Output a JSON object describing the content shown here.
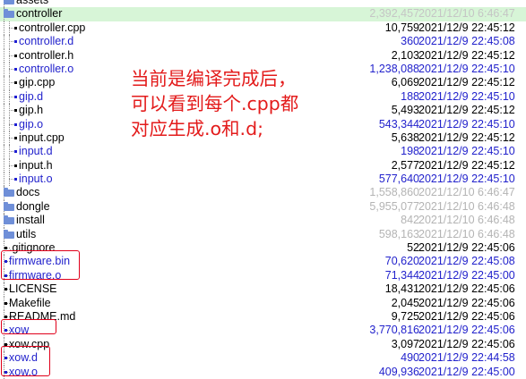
{
  "rows": [
    {
      "kind": "folder",
      "depth": 0,
      "name": "assets",
      "size": "",
      "date": "",
      "style": "",
      "partial": true
    },
    {
      "kind": "folder",
      "depth": 0,
      "name": "controller",
      "size": "2,392,457",
      "date": "2021/12/10 6:46:47",
      "style": "selected"
    },
    {
      "kind": "file",
      "depth": 1,
      "name": "controller.cpp",
      "size": "10,759",
      "date": "2021/12/9 22:45:12",
      "style": ""
    },
    {
      "kind": "file",
      "depth": 1,
      "name": "controller.d",
      "size": "360",
      "date": "2021/12/9 22:45:08",
      "style": "blue"
    },
    {
      "kind": "file",
      "depth": 1,
      "name": "controller.h",
      "size": "2,103",
      "date": "2021/12/9 22:45:12",
      "style": ""
    },
    {
      "kind": "file",
      "depth": 1,
      "name": "controller.o",
      "size": "1,238,088",
      "date": "2021/12/9 22:45:10",
      "style": "blue"
    },
    {
      "kind": "file",
      "depth": 1,
      "name": "gip.cpp",
      "size": "6,069",
      "date": "2021/12/9 22:45:12",
      "style": ""
    },
    {
      "kind": "file",
      "depth": 1,
      "name": "gip.d",
      "size": "188",
      "date": "2021/12/9 22:45:10",
      "style": "blue"
    },
    {
      "kind": "file",
      "depth": 1,
      "name": "gip.h",
      "size": "5,493",
      "date": "2021/12/9 22:45:12",
      "style": ""
    },
    {
      "kind": "file",
      "depth": 1,
      "name": "gip.o",
      "size": "543,344",
      "date": "2021/12/9 22:45:10",
      "style": "blue"
    },
    {
      "kind": "file",
      "depth": 1,
      "name": "input.cpp",
      "size": "5,638",
      "date": "2021/12/9 22:45:12",
      "style": ""
    },
    {
      "kind": "file",
      "depth": 1,
      "name": "input.d",
      "size": "198",
      "date": "2021/12/9 22:45:10",
      "style": "blue"
    },
    {
      "kind": "file",
      "depth": 1,
      "name": "input.h",
      "size": "2,577",
      "date": "2021/12/9 22:45:12",
      "style": ""
    },
    {
      "kind": "file",
      "depth": 1,
      "name": "input.o",
      "size": "577,640",
      "date": "2021/12/9 22:45:10",
      "style": "blue"
    },
    {
      "kind": "folder",
      "depth": 0,
      "name": "docs",
      "size": "1,558,860",
      "date": "2021/12/10 6:46:47",
      "style": "grey"
    },
    {
      "kind": "folder",
      "depth": 0,
      "name": "dongle",
      "size": "5,955,077",
      "date": "2021/12/10 6:46:48",
      "style": "grey"
    },
    {
      "kind": "folder",
      "depth": 0,
      "name": "install",
      "size": "842",
      "date": "2021/12/10 6:46:48",
      "style": "grey"
    },
    {
      "kind": "folder",
      "depth": 0,
      "name": "utils",
      "size": "598,163",
      "date": "2021/12/10 6:46:48",
      "style": "grey"
    },
    {
      "kind": "file",
      "depth": 0,
      "name": ".gitignore",
      "size": "52",
      "date": "2021/12/9 22:45:06",
      "style": ""
    },
    {
      "kind": "file",
      "depth": 0,
      "name": "firmware.bin",
      "size": "70,620",
      "date": "2021/12/9 22:45:08",
      "style": "blue"
    },
    {
      "kind": "file",
      "depth": 0,
      "name": "firmware.o",
      "size": "71,344",
      "date": "2021/12/9 22:45:00",
      "style": "blue"
    },
    {
      "kind": "file",
      "depth": 0,
      "name": "LICENSE",
      "size": "18,431",
      "date": "2021/12/9 22:45:06",
      "style": ""
    },
    {
      "kind": "file",
      "depth": 0,
      "name": "Makefile",
      "size": "2,045",
      "date": "2021/12/9 22:45:06",
      "style": ""
    },
    {
      "kind": "file",
      "depth": 0,
      "name": "README.md",
      "size": "9,725",
      "date": "2021/12/9 22:45:06",
      "style": ""
    },
    {
      "kind": "file",
      "depth": 0,
      "name": "xow",
      "size": "3,770,816",
      "date": "2021/12/9 22:45:06",
      "style": "blue"
    },
    {
      "kind": "file",
      "depth": 0,
      "name": "xow.cpp",
      "size": "3,097",
      "date": "2021/12/9 22:45:06",
      "style": ""
    },
    {
      "kind": "file",
      "depth": 0,
      "name": "xow.d",
      "size": "490",
      "date": "2021/12/9 22:44:58",
      "style": "blue"
    },
    {
      "kind": "file",
      "depth": 0,
      "name": "xow.o",
      "size": "409,936",
      "date": "2021/12/9 22:45:00",
      "style": "blue"
    }
  ],
  "annotation": {
    "text": "当前是编译完成后，\n可以看到每个.cpp都\n对应生成.o和.d;",
    "color": "#e31b1b"
  },
  "colors": {
    "generated_file": "#2222cc",
    "folder_icon": "#6f8fd8",
    "selected_row": "#d7f5d7",
    "highlight_box": "#e0001a"
  }
}
